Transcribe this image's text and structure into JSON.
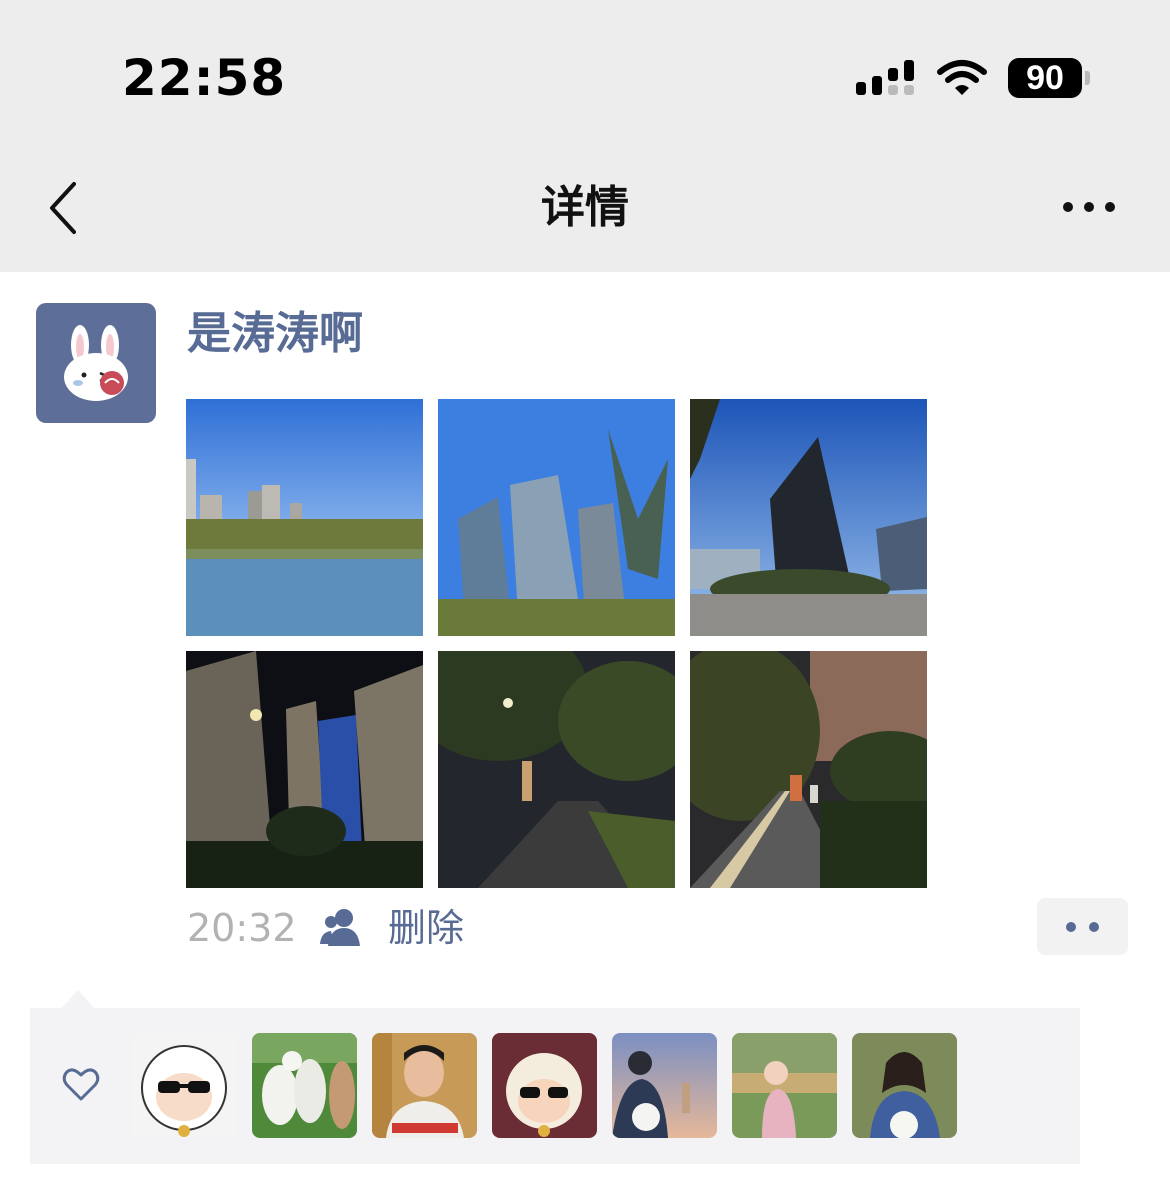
{
  "status_bar": {
    "time": "22:58",
    "battery": "90"
  },
  "nav": {
    "title": "详情"
  },
  "post": {
    "author": "是涛涛啊",
    "time": "20:32",
    "delete_label": "删除",
    "photos": [
      {
        "description": "daytime lake with city buildings"
      },
      {
        "description": "glass high-rise against blue sky"
      },
      {
        "description": "dark triangular tower with sky"
      },
      {
        "description": "night city towers with blue lights"
      },
      {
        "description": "night tree-lined path"
      },
      {
        "description": "night walkway with people"
      }
    ]
  },
  "likes": {
    "likers": [
      {
        "name": "sheep-sunglasses-avatar"
      },
      {
        "name": "alpacas-avatar"
      },
      {
        "name": "man-portrait-avatar"
      },
      {
        "name": "sheep-cartoon-avatar"
      },
      {
        "name": "flowers-city-avatar"
      },
      {
        "name": "girl-grass-avatar"
      },
      {
        "name": "woman-flowers-avatar"
      }
    ]
  },
  "colors": {
    "link": "#576b95",
    "header_bg": "#ededed",
    "meta_gray": "#b2b2b2"
  }
}
